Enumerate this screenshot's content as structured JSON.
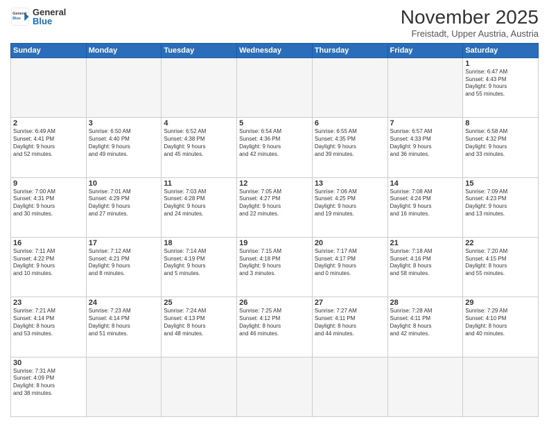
{
  "header": {
    "logo_general": "General",
    "logo_blue": "Blue",
    "title": "November 2025",
    "subtitle": "Freistadt, Upper Austria, Austria"
  },
  "days_of_week": [
    "Sunday",
    "Monday",
    "Tuesday",
    "Wednesday",
    "Thursday",
    "Friday",
    "Saturday"
  ],
  "weeks": [
    [
      {
        "day": "",
        "empty": true
      },
      {
        "day": "",
        "empty": true
      },
      {
        "day": "",
        "empty": true
      },
      {
        "day": "",
        "empty": true
      },
      {
        "day": "",
        "empty": true
      },
      {
        "day": "",
        "empty": true
      },
      {
        "day": "1",
        "sunrise": "6:47 AM",
        "sunset": "4:43 PM",
        "daylight": "9 hours and 55 minutes."
      }
    ],
    [
      {
        "day": "2",
        "sunrise": "6:49 AM",
        "sunset": "4:41 PM",
        "daylight": "9 hours and 52 minutes."
      },
      {
        "day": "3",
        "sunrise": "6:50 AM",
        "sunset": "4:40 PM",
        "daylight": "9 hours and 49 minutes."
      },
      {
        "day": "4",
        "sunrise": "6:52 AM",
        "sunset": "4:38 PM",
        "daylight": "9 hours and 45 minutes."
      },
      {
        "day": "5",
        "sunrise": "6:54 AM",
        "sunset": "4:36 PM",
        "daylight": "9 hours and 42 minutes."
      },
      {
        "day": "6",
        "sunrise": "6:55 AM",
        "sunset": "4:35 PM",
        "daylight": "9 hours and 39 minutes."
      },
      {
        "day": "7",
        "sunrise": "6:57 AM",
        "sunset": "4:33 PM",
        "daylight": "9 hours and 36 minutes."
      },
      {
        "day": "8",
        "sunrise": "6:58 AM",
        "sunset": "4:32 PM",
        "daylight": "9 hours and 33 minutes."
      }
    ],
    [
      {
        "day": "9",
        "sunrise": "7:00 AM",
        "sunset": "4:31 PM",
        "daylight": "9 hours and 30 minutes."
      },
      {
        "day": "10",
        "sunrise": "7:01 AM",
        "sunset": "4:29 PM",
        "daylight": "9 hours and 27 minutes."
      },
      {
        "day": "11",
        "sunrise": "7:03 AM",
        "sunset": "4:28 PM",
        "daylight": "9 hours and 24 minutes."
      },
      {
        "day": "12",
        "sunrise": "7:05 AM",
        "sunset": "4:27 PM",
        "daylight": "9 hours and 22 minutes."
      },
      {
        "day": "13",
        "sunrise": "7:06 AM",
        "sunset": "4:25 PM",
        "daylight": "9 hours and 19 minutes."
      },
      {
        "day": "14",
        "sunrise": "7:08 AM",
        "sunset": "4:24 PM",
        "daylight": "9 hours and 16 minutes."
      },
      {
        "day": "15",
        "sunrise": "7:09 AM",
        "sunset": "4:23 PM",
        "daylight": "9 hours and 13 minutes."
      }
    ],
    [
      {
        "day": "16",
        "sunrise": "7:11 AM",
        "sunset": "4:22 PM",
        "daylight": "9 hours and 10 minutes."
      },
      {
        "day": "17",
        "sunrise": "7:12 AM",
        "sunset": "4:21 PM",
        "daylight": "9 hours and 8 minutes."
      },
      {
        "day": "18",
        "sunrise": "7:14 AM",
        "sunset": "4:19 PM",
        "daylight": "9 hours and 5 minutes."
      },
      {
        "day": "19",
        "sunrise": "7:15 AM",
        "sunset": "4:18 PM",
        "daylight": "9 hours and 3 minutes."
      },
      {
        "day": "20",
        "sunrise": "7:17 AM",
        "sunset": "4:17 PM",
        "daylight": "9 hours and 0 minutes."
      },
      {
        "day": "21",
        "sunrise": "7:18 AM",
        "sunset": "4:16 PM",
        "daylight": "8 hours and 58 minutes."
      },
      {
        "day": "22",
        "sunrise": "7:20 AM",
        "sunset": "4:15 PM",
        "daylight": "8 hours and 55 minutes."
      }
    ],
    [
      {
        "day": "23",
        "sunrise": "7:21 AM",
        "sunset": "4:14 PM",
        "daylight": "8 hours and 53 minutes."
      },
      {
        "day": "24",
        "sunrise": "7:23 AM",
        "sunset": "4:14 PM",
        "daylight": "8 hours and 51 minutes."
      },
      {
        "day": "25",
        "sunrise": "7:24 AM",
        "sunset": "4:13 PM",
        "daylight": "8 hours and 48 minutes."
      },
      {
        "day": "26",
        "sunrise": "7:25 AM",
        "sunset": "4:12 PM",
        "daylight": "8 hours and 46 minutes."
      },
      {
        "day": "27",
        "sunrise": "7:27 AM",
        "sunset": "4:11 PM",
        "daylight": "8 hours and 44 minutes."
      },
      {
        "day": "28",
        "sunrise": "7:28 AM",
        "sunset": "4:11 PM",
        "daylight": "8 hours and 42 minutes."
      },
      {
        "day": "29",
        "sunrise": "7:29 AM",
        "sunset": "4:10 PM",
        "daylight": "8 hours and 40 minutes."
      }
    ],
    [
      {
        "day": "30",
        "sunrise": "7:31 AM",
        "sunset": "4:09 PM",
        "daylight": "8 hours and 38 minutes."
      },
      {
        "day": "",
        "empty": true
      },
      {
        "day": "",
        "empty": true
      },
      {
        "day": "",
        "empty": true
      },
      {
        "day": "",
        "empty": true
      },
      {
        "day": "",
        "empty": true
      },
      {
        "day": "",
        "empty": true
      }
    ]
  ],
  "labels": {
    "sunrise": "Sunrise:",
    "sunset": "Sunset:",
    "daylight": "Daylight:"
  }
}
